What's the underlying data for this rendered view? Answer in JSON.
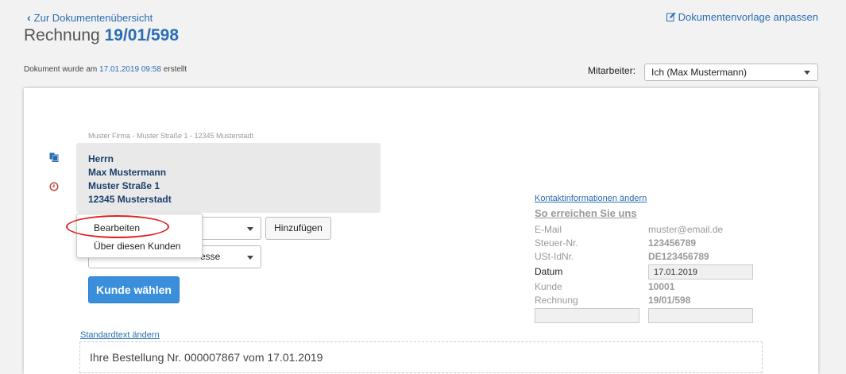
{
  "header": {
    "back_link": "Zur Dokumentenübersicht",
    "template_link": "Dokumentenvorlage anpassen",
    "title_prefix": "Rechnung",
    "title_number": "19/01/598"
  },
  "meta": {
    "created_prefix": "Dokument wurde am",
    "created_timestamp": "17.01.2019 09:58",
    "created_suffix": "erstellt",
    "employee_label": "Mitarbeiter:",
    "employee_value": "Ich (Max Mustermann)"
  },
  "document": {
    "sender_line": "Muster Firma - Muster Straße 1 - 12345 Musterstadt",
    "address": [
      "Herrn",
      "Max Mustermann",
      "Muster Straße 1",
      "12345 Musterstadt"
    ],
    "select2_visible_text": "esse",
    "add_button": "Hinzufügen",
    "choose_customer_button": "Kunde wählen",
    "dropdown_items": [
      "Bearbeiten",
      "Über diesen Kunden"
    ],
    "contact_link": "Kontaktinformationen ändern",
    "reach_heading": "So erreichen Sie uns",
    "info": [
      {
        "label": "E-Mail",
        "value": "muster@email.de"
      },
      {
        "label": "Steuer-Nr.",
        "value": "123456789"
      },
      {
        "label": "USt-IdNr.",
        "value": "DE123456789"
      },
      {
        "label": "Datum",
        "value": "17.01.2019"
      },
      {
        "label": "Kunde",
        "value": "10001"
      },
      {
        "label": "Rechnung",
        "value": "19/01/598"
      }
    ],
    "std_text_link": "Standardtext ändern",
    "order_text": "Ihre Bestellung Nr. 000007867 vom 17.01.2019"
  },
  "colors": {
    "accent": "#2a6db3",
    "primary_button": "#3a8fdd",
    "highlight_ellipse": "#e02020"
  }
}
